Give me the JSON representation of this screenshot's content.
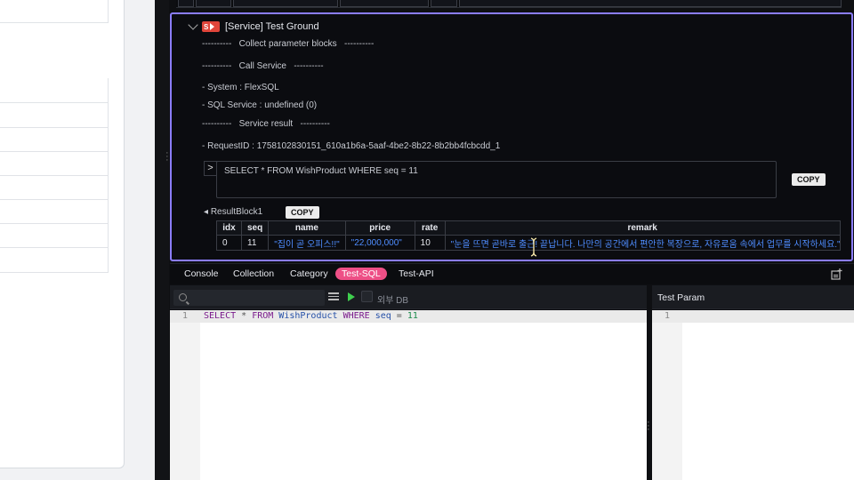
{
  "service_block": {
    "title": "[Service] Test Ground",
    "icon_text": "S",
    "lines": [
      "----------   Collect parameter blocks   ----------",
      "----------   Call Service   ----------",
      "- System : FlexSQL",
      "- SQL Service : undefined (0)",
      "----------   Service result   ----------",
      "- RequestID : 1758102830151_610a1b6a-5aaf-4be2-8b22-8b2bb4fcbcdd_1"
    ],
    "query": "SELECT * FROM WishProduct WHERE seq = 11",
    "query_expand": ">",
    "copy_label": "COPY",
    "result_label": "ResultBlock1",
    "result_copy_label": "COPY",
    "table": {
      "columns": [
        "idx",
        "seq",
        "name",
        "price",
        "rate",
        "remark"
      ],
      "rows": [
        [
          "0",
          "11",
          "\"집이 곧 오피스!!\"",
          "\"22,000,000\"",
          "10",
          "\"눈을 뜨면 곧바로 출근! 끝납니다. 나만의 공간에서 편안한 복장으로, 자유로움 속에서 업무를 시작하세요.\""
        ]
      ]
    }
  },
  "tabs": [
    {
      "label": "Console",
      "active": false
    },
    {
      "label": "Collection",
      "active": false
    },
    {
      "label": "Category",
      "active": false
    },
    {
      "label": "Test-SQL",
      "active": true
    },
    {
      "label": "Test-API",
      "active": false
    }
  ],
  "editor": {
    "ext_db_label": "외부 DB",
    "line_number": "1",
    "code_tokens": [
      {
        "t": "SELECT",
        "c": "kw"
      },
      {
        "t": " * ",
        "c": "op"
      },
      {
        "t": "FROM",
        "c": "kw"
      },
      {
        "t": " WishProduct ",
        "c": "id"
      },
      {
        "t": "WHERE",
        "c": "kw"
      },
      {
        "t": " seq ",
        "c": "id"
      },
      {
        "t": "=",
        "c": "op"
      },
      {
        "t": " 11",
        "c": "num"
      }
    ]
  },
  "test_param": {
    "title": "Test Param",
    "line_number": "1"
  },
  "colors": {
    "highlight_border": "#8b7dff",
    "active_tab": "#ee4f86",
    "run_button": "#3fcf4e",
    "string_value": "#4f8dff"
  }
}
